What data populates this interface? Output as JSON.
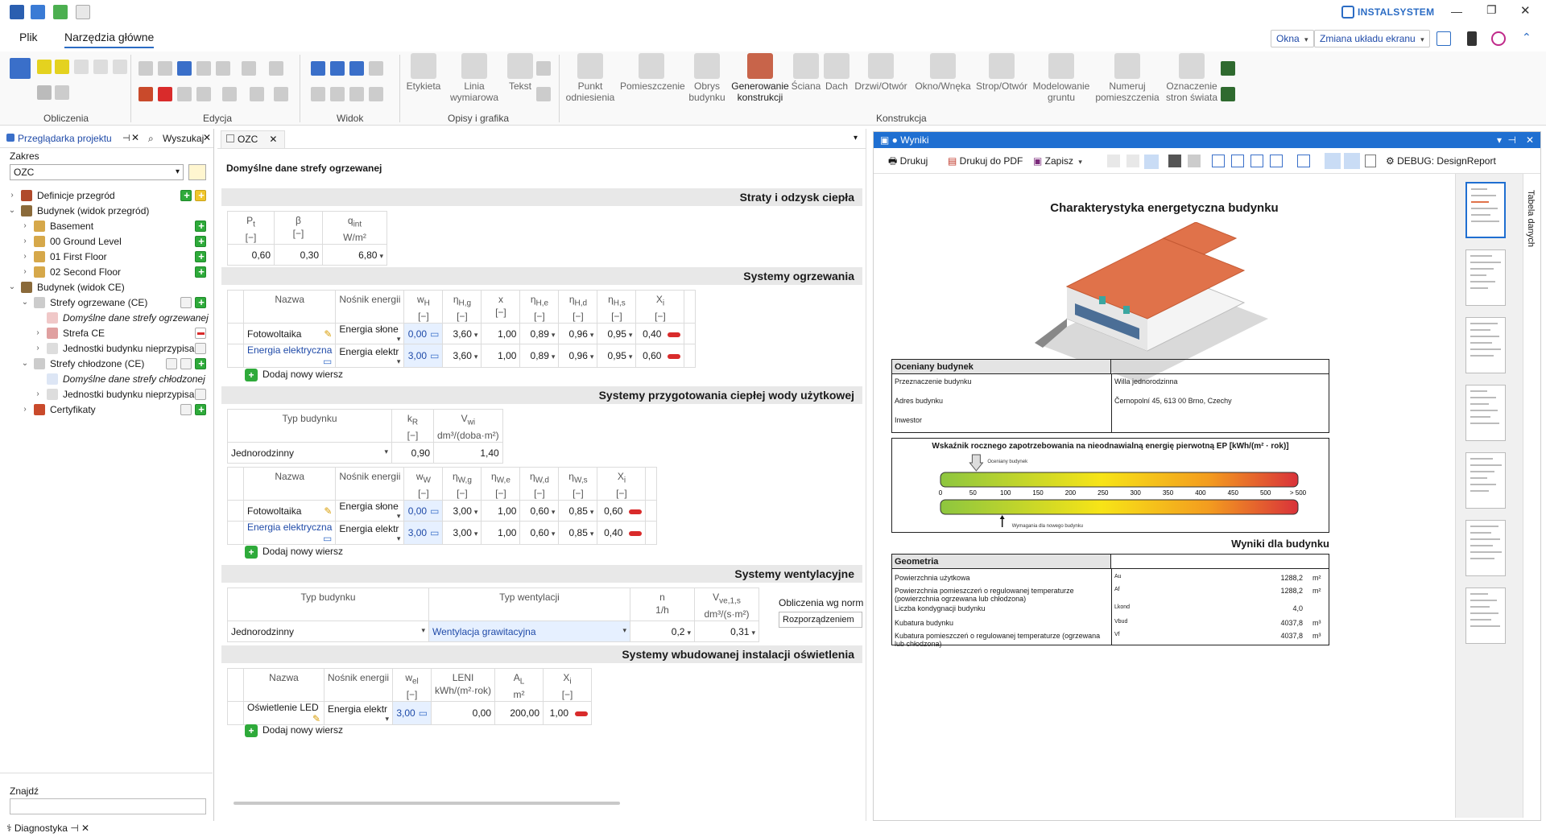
{
  "app": {
    "logo_text": "INSTALSYSTEM",
    "window_controls": [
      "minimize-icon",
      "restore-icon",
      "close-icon"
    ]
  },
  "menu": {
    "items": [
      "Plik",
      "Narzędzia główne"
    ],
    "right": {
      "okna": "Okna",
      "layout": "Zmiana układu ekranu"
    }
  },
  "ribbon": {
    "groups": [
      "Obliczenia",
      "Edycja",
      "Widok",
      "Opisy i grafika",
      "Konstrukcja"
    ],
    "opisy": [
      "Etykieta",
      "Linia wymiarowa",
      "Tekst"
    ],
    "konstrukcja": [
      "Punkt odniesienia",
      "Pomieszczenie",
      "Obrys budynku",
      "Generowanie konstrukcji",
      "Ściana",
      "Dach",
      "Drzwi/Otwór",
      "Okno/Wnęka",
      "Strop/Otwór",
      "Modelowanie gruntu",
      "Numeruj pomieszczenia",
      "Oznaczenie stron świata"
    ]
  },
  "left": {
    "tabs": [
      "Przeglądarka projektu",
      "Wyszukaj"
    ],
    "zakres_label": "Zakres",
    "zakres_value": "OZC",
    "tree": [
      {
        "label": "Definicje przegród",
        "level": 0,
        "exp": ">"
      },
      {
        "label": "Budynek (widok przegród)",
        "level": 0,
        "exp": "v"
      },
      {
        "label": "Basement",
        "level": 1,
        "exp": ">"
      },
      {
        "label": "00 Ground Level",
        "level": 1,
        "exp": ">"
      },
      {
        "label": "01 First Floor",
        "level": 1,
        "exp": ">"
      },
      {
        "label": "02 Second Floor",
        "level": 1,
        "exp": ">"
      },
      {
        "label": "Budynek (widok CE)",
        "level": 0,
        "exp": "v"
      },
      {
        "label": "Strefy ogrzewane (CE)",
        "level": 1,
        "exp": "v"
      },
      {
        "label": "Domyślne dane strefy ogrzewanej",
        "level": 2,
        "exp": ""
      },
      {
        "label": "Strefa CE",
        "level": 2,
        "exp": ">"
      },
      {
        "label": "Jednostki budynku nieprzypisane",
        "level": 2,
        "exp": ">"
      },
      {
        "label": "Strefy chłodzone (CE)",
        "level": 1,
        "exp": "v"
      },
      {
        "label": "Domyślne dane strefy chłodzonej",
        "level": 2,
        "exp": ""
      },
      {
        "label": "Jednostki budynku nieprzypisane",
        "level": 2,
        "exp": ">"
      },
      {
        "label": "Certyfikaty",
        "level": 1,
        "exp": ">"
      }
    ],
    "find_label": "Znajdź",
    "bottom_tab": "Diagnostyka"
  },
  "center": {
    "tab": "OZC",
    "title": "Domyślne dane strefy ogrzewanej",
    "s1": {
      "title": "Straty i odzysk ciepła",
      "headers": [
        [
          "P",
          "[−]"
        ],
        [
          "β",
          "[−]"
        ],
        [
          "q",
          "W/m²"
        ]
      ],
      "values": [
        "0,60",
        "0,30",
        "6,80"
      ]
    },
    "s2": {
      "title": "Systemy ogrzewania",
      "headers": [
        [
          "Nazwa",
          ""
        ],
        [
          "Nośnik energii",
          ""
        ],
        [
          "w",
          "[−]"
        ],
        [
          "η",
          "[−]"
        ],
        [
          "x",
          "[−]"
        ],
        [
          "η",
          "[−]"
        ],
        [
          "η",
          "[−]"
        ],
        [
          "η",
          "[−]"
        ],
        [
          "X",
          "[−]"
        ]
      ],
      "rows": [
        [
          "Fotowoltaika",
          "Energia słone",
          "0,00",
          "3,60",
          "1,00",
          "0,89",
          "0,96",
          "0,95",
          "0,40"
        ],
        [
          "Energia elektryczna",
          "Energia elektr",
          "3,00",
          "3,60",
          "1,00",
          "0,89",
          "0,96",
          "0,95",
          "0,60"
        ]
      ],
      "add": "Dodaj nowy wiersz"
    },
    "s3": {
      "title": "Systemy przygotowania ciepłej wody użytkowej",
      "b_headers": [
        [
          "Typ budynku",
          ""
        ],
        [
          "k",
          "[−]"
        ],
        [
          "V",
          "dm³/(doba·m²)"
        ]
      ],
      "b_row": [
        "Jednorodzinny",
        "0,90",
        "1,40"
      ],
      "headers": [
        [
          "Nazwa",
          ""
        ],
        [
          "Nośnik energii",
          ""
        ],
        [
          "w",
          "[−]"
        ],
        [
          "η",
          "[−]"
        ],
        [
          "η",
          "[−]"
        ],
        [
          "η",
          "[−]"
        ],
        [
          "η",
          "[−]"
        ],
        [
          "X",
          "[−]"
        ]
      ],
      "rows": [
        [
          "Fotowoltaika",
          "Energia słone",
          "0,00",
          "3,00",
          "1,00",
          "0,60",
          "0,85",
          "0,60"
        ],
        [
          "Energia elektryczna",
          "Energia elektr",
          "3,00",
          "3,00",
          "1,00",
          "0,60",
          "0,85",
          "0,40"
        ]
      ],
      "add": "Dodaj nowy wiersz"
    },
    "s4": {
      "title": "Systemy wentylacyjne",
      "headers": [
        [
          "Typ budynku",
          ""
        ],
        [
          "Typ wentylacji",
          ""
        ],
        [
          "n",
          "1/h"
        ],
        [
          "V",
          "dm³/(s·m²)"
        ]
      ],
      "row": [
        "Jednorodzinny",
        "Wentylacja grawitacyjna",
        "0,2",
        "0,31"
      ],
      "obl_label": "Obliczenia wg norm",
      "obl_value": "Rozporządzeniem"
    },
    "s5": {
      "title": "Systemy wbudowanej instalacji oświetlenia",
      "headers": [
        [
          "Nazwa",
          ""
        ],
        [
          "Nośnik energii",
          ""
        ],
        [
          "w",
          "[−]"
        ],
        [
          "LENI",
          "kWh/(m²·rok)"
        ],
        [
          "A",
          "m²"
        ],
        [
          "X",
          "[−]"
        ]
      ],
      "row": [
        "Oświetlenie LED",
        "Energia elektr",
        "3,00",
        "0,00",
        "200,00",
        "1,00"
      ],
      "add": "Dodaj nowy wiersz"
    }
  },
  "right": {
    "title": "Wyniki",
    "toolbar": {
      "print": "Drukuj",
      "pdf": "Drukuj do PDF",
      "save": "Zapisz",
      "debug": "DEBUG: DesignReport"
    },
    "side_tab": "Tabela danych",
    "report": {
      "title": "Charakterystyka energetyczna budynku",
      "box1_head": "Oceniany budynek",
      "box1_rows": [
        [
          "Przeznaczenie budynku",
          "Willa jednorodzinna"
        ],
        [
          "Adres budynku",
          "Černopolní 45, 613 00 Brno, Czechy"
        ],
        [
          "Inwestor",
          ""
        ]
      ],
      "ep_title": "Wskaźnik rocznego zapotrzebowania na nieodnawialną energię pierwotną EP [kWh/(m² · rok)]",
      "ep_top_label": "Oceniany budynek",
      "ep_bottom_label": "Wymagania dla nowego budynku",
      "ep_ticks": [
        "0",
        "50",
        "100",
        "150",
        "200",
        "250",
        "300",
        "350",
        "400",
        "450",
        "500",
        "> 500"
      ],
      "ep_value": 55,
      "ep_requirement": 95,
      "wyniki": "Wyniki dla budynku",
      "geo_head": "Geometria",
      "geo_rows": [
        [
          "Powierzchnia użytkowa",
          "Au",
          "1288,2",
          "m²"
        ],
        [
          "Powierzchnia pomieszczeń o regulowanej temperaturze  (powierzchnia ogrzewana lub chłodzona)",
          "Af",
          "1288,2",
          "m²"
        ],
        [
          "Liczba kondygnacji budynku",
          "Lkond",
          "4,0",
          ""
        ],
        [
          "Kubatura budynku",
          "Vbud",
          "4037,8",
          "m³"
        ],
        [
          "Kubatura pomieszczeń o regulowanej temperaturze  (ogrzewana lub chłodzona)",
          "Vf",
          "4037,8",
          "m³"
        ]
      ]
    }
  }
}
